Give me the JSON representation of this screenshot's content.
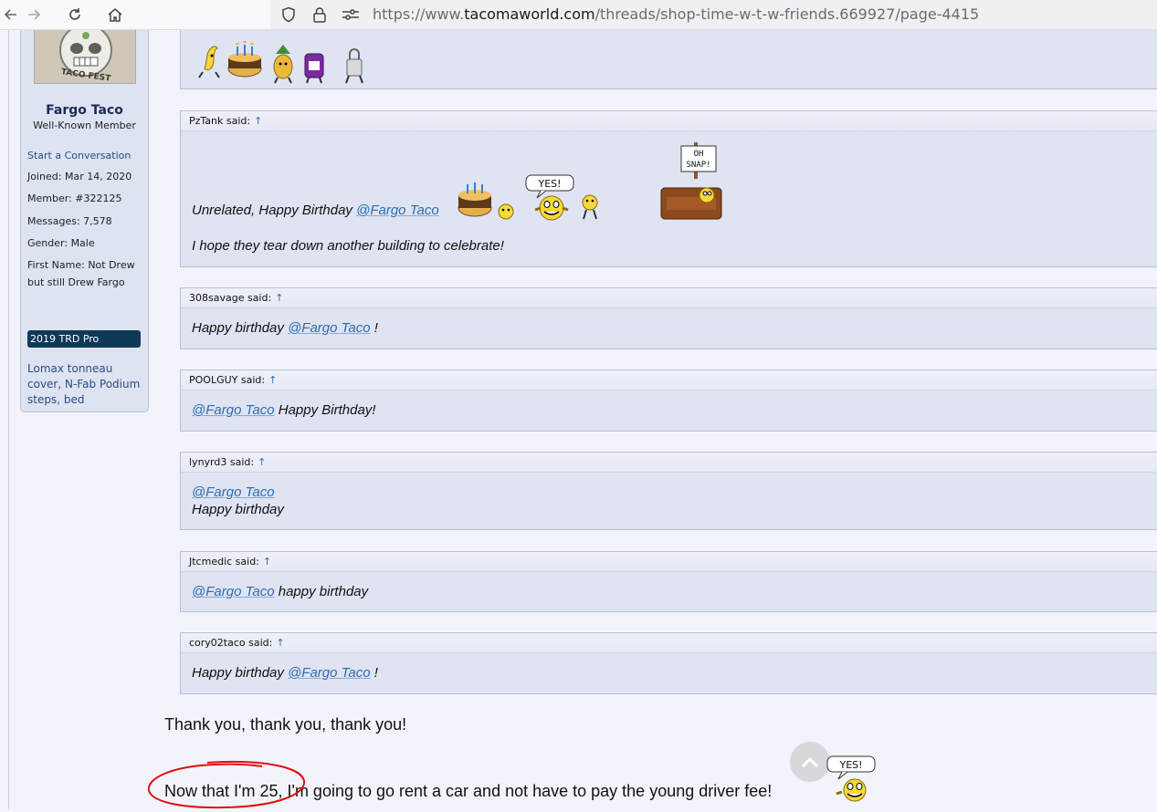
{
  "browser": {
    "url_prefix": "https://www.",
    "url_domain": "tacomaworld.com",
    "url_path": "/threads/shop-time-w-t-w-friends.669927/page-4415"
  },
  "user": {
    "name": "Fargo Taco",
    "title": "Well-Known Member",
    "start_conversation": "Start a Conversation",
    "stats": [
      {
        "label": "Joined:",
        "value": "Mar 14, 2020"
      },
      {
        "label": "Member:",
        "value": "#322125"
      },
      {
        "label": "Messages:",
        "value": "7,578"
      },
      {
        "label": "Gender:",
        "value": "Male"
      },
      {
        "label": "First Name:",
        "value": "Not Drew but still Drew Fargo"
      }
    ],
    "badge": "2019 TRD Pro",
    "signature": "Lomax tonneau cover, N-Fab Podium steps, bed"
  },
  "quotes": [
    {
      "author": "PzTank said:",
      "arrow": "↑",
      "text_before": "Unrelated, Happy Birthday ",
      "mention": "@Fargo Taco",
      "text_after": "",
      "line2": "I hope they tear down another building to celebrate!"
    },
    {
      "author": "308savage said:",
      "arrow": "↑",
      "text_before": "Happy birthday ",
      "mention": "@Fargo Taco",
      "text_after": " !"
    },
    {
      "author": "POOLGUY said:",
      "arrow": "↑",
      "text_before": "",
      "mention": "@Fargo Taco",
      "text_after": " Happy Birthday!"
    },
    {
      "author": "lynyrd3 said:",
      "arrow": "↑",
      "text_before": "",
      "mention": "@Fargo Taco",
      "text_after": "",
      "line2": "Happy birthday"
    },
    {
      "author": "Jtcmedic said:",
      "arrow": "↑",
      "text_before": "",
      "mention": "@Fargo Taco",
      "text_after": " happy birthday"
    },
    {
      "author": "cory02taco said:",
      "arrow": "↑",
      "text_before": "Happy birthday ",
      "mention": "@Fargo Taco",
      "text_after": " !"
    }
  ],
  "smilies": {
    "yes_bubble": "YES!",
    "oh_snap": "OH SNAP!"
  },
  "reply": {
    "line1": "Thank you, thank you, thank you!",
    "line2_circled": "Now that I'm 25,",
    "line2_rest": " I'm going to go rent a car and not have to pay the young driver fee!"
  },
  "colors": {
    "link": "#2c6db0",
    "badge": "#0e3957",
    "quote_bg": "#dfe3f2",
    "annotation": "#e01010"
  }
}
